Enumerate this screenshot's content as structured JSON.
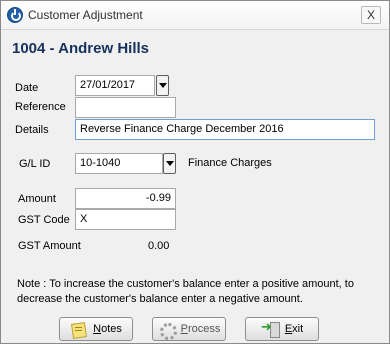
{
  "window": {
    "title": "Customer Adjustment",
    "close_glyph": "X"
  },
  "customer": {
    "heading": "1004 - Andrew Hills"
  },
  "form": {
    "date_label": "Date",
    "date_value": "27/01/2017",
    "reference_label": "Reference",
    "reference_value": "",
    "details_label": "Details",
    "details_value": "Reverse Finance Charge December 2016",
    "glid_label": "G/L ID",
    "glid_value": "10-1040",
    "glid_description": "Finance Charges",
    "amount_label": "Amount",
    "amount_value": "-0.99",
    "gst_code_label": "GST Code",
    "gst_code_value": "X",
    "gst_amount_label": "GST Amount",
    "gst_amount_value": "0.00"
  },
  "note": "Note : To increase the customer's balance enter a positive amount, to decrease the customer's balance enter a negative amount.",
  "buttons": {
    "notes_mnemonic": "N",
    "notes_rest": "otes",
    "process_mnemonic": "P",
    "process_rest": "rocess",
    "exit_mnemonic": "E",
    "exit_rest": "xit"
  },
  "icons": {
    "app": "power-icon",
    "notes": "sticky-note-icon",
    "process": "gear-icon",
    "exit": "exit-door-icon",
    "dropdown": "chevron-down-icon"
  }
}
